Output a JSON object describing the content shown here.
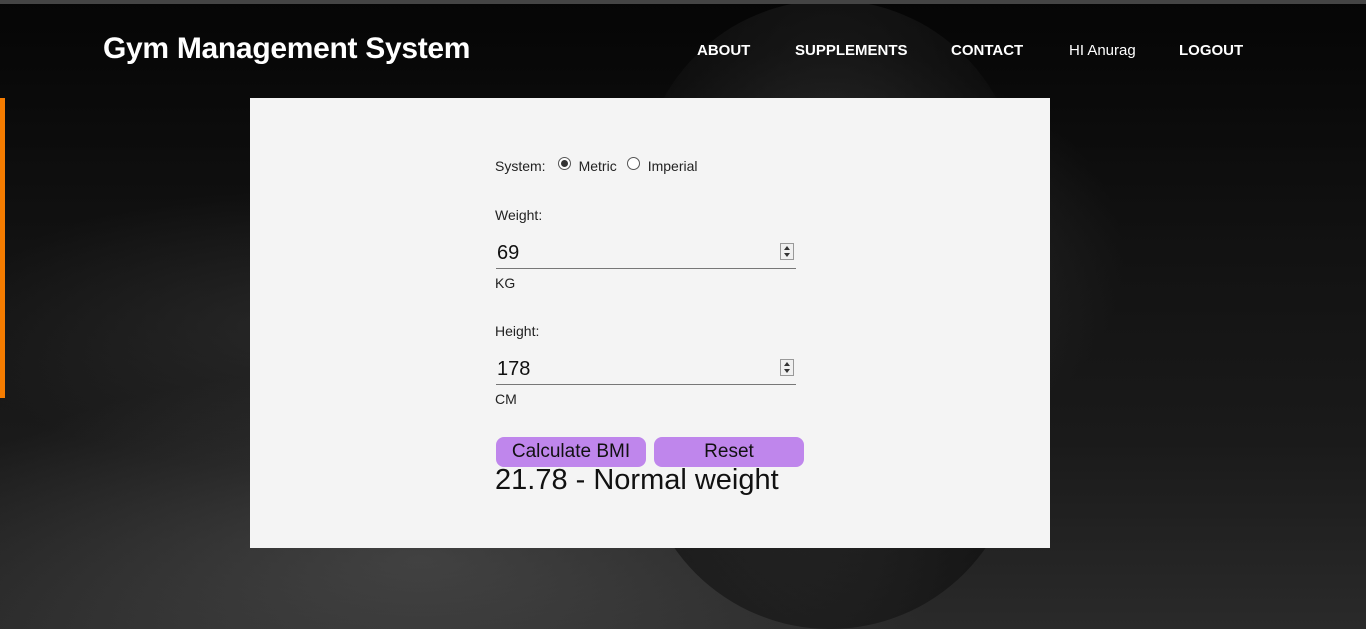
{
  "header": {
    "brand": "Gym Management System",
    "nav": [
      "ABOUT",
      "SUPPLEMENTS",
      "CONTACT"
    ],
    "greeting": "HI Anurag",
    "logout": "LOGOUT"
  },
  "form": {
    "system_label": "System:",
    "system_options": [
      "Metric",
      "Imperial"
    ],
    "system_selected": "Metric",
    "weight_label": "Weight:",
    "weight_value": "69",
    "weight_unit": "KG",
    "height_label": "Height:",
    "height_value": "178",
    "height_unit": "CM",
    "calculate_label": "Calculate BMI",
    "reset_label": "Reset",
    "result": "21.78 - Normal weight"
  },
  "colors": {
    "accent": "#f57c00",
    "button": "#bf86ec",
    "card": "#f4f4f4"
  }
}
